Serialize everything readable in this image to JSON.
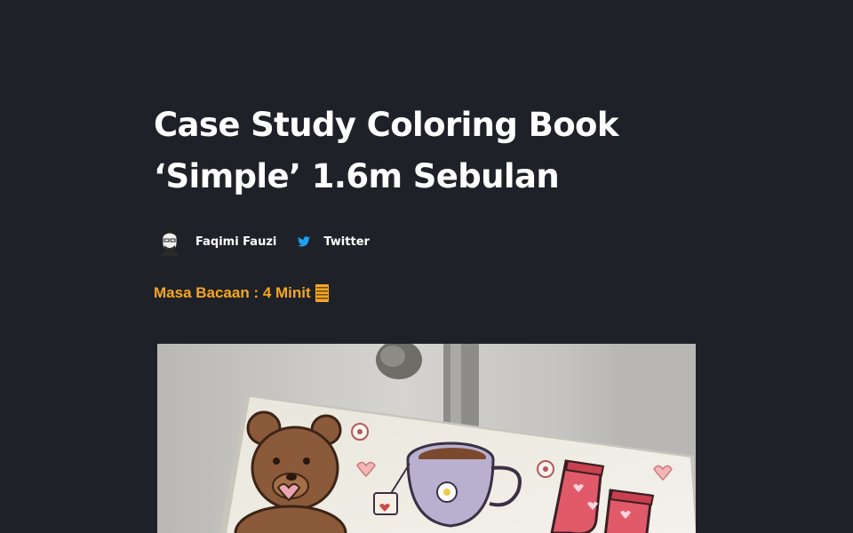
{
  "article": {
    "title_line1": "Case Study Coloring Book",
    "title_line2": "‘Simple’ 1.6m Sebulan",
    "author": "Faqimi Fauzi",
    "social_label": "Twitter",
    "reading_time": "Masa Bacaan : 4 Minit"
  },
  "colors": {
    "background": "#1f2128",
    "accent": "#f5a623",
    "twitter": "#1da1f2"
  },
  "icons": {
    "avatar": "avatar-illustration-icon",
    "social": "twitter-icon",
    "reading": "book-stack-icon"
  }
}
